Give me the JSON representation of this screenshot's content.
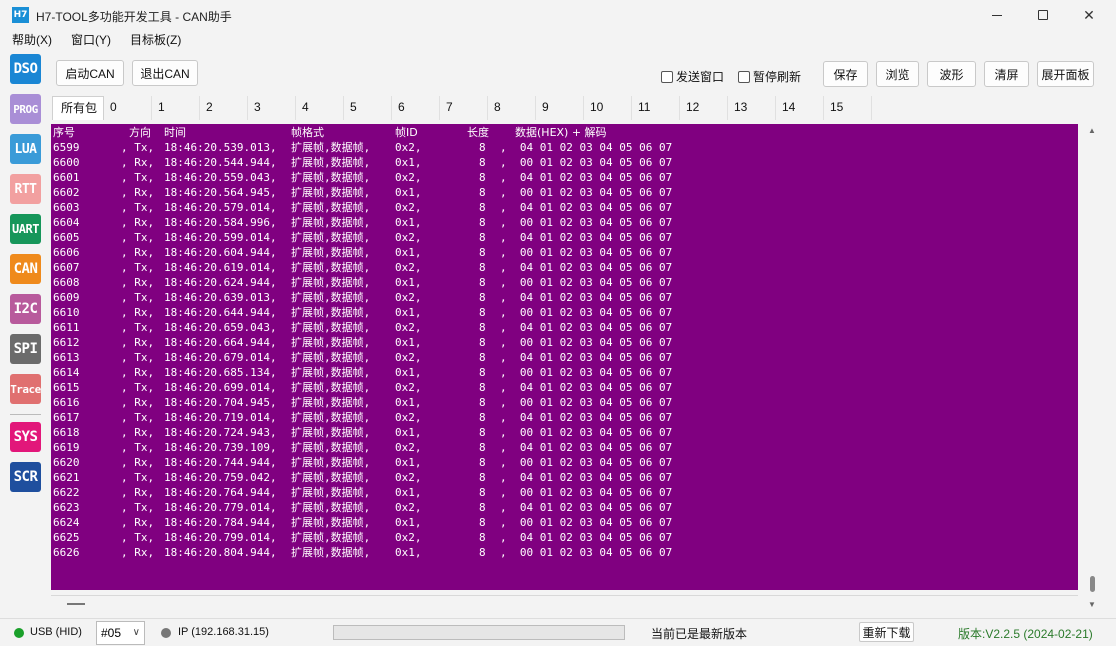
{
  "window": {
    "icon_text": "H7",
    "title": "H7-TOOL多功能开发工具 - CAN助手"
  },
  "menu": [
    "帮助(X)",
    "窗口(Y)",
    "目标板(Z)"
  ],
  "sidebar": [
    {
      "label": "DSO",
      "color": "#1a86d4"
    },
    {
      "label": "PROG",
      "color": "#a98ed6"
    },
    {
      "label": "LUA",
      "color": "#3a9bd8"
    },
    {
      "label": "RTT",
      "color": "#f2a0a0"
    },
    {
      "label": "UART",
      "color": "#16965a"
    },
    {
      "label": "CAN",
      "color": "#ef8a1c"
    },
    {
      "label": "I2C",
      "color": "#b85a9c"
    },
    {
      "label": "SPI",
      "color": "#6b6b6b"
    },
    {
      "label": "Trace",
      "color": "#e07070"
    },
    {
      "label": "SYS",
      "color": "#e2177a"
    },
    {
      "label": "SCR",
      "color": "#1f4f9e"
    }
  ],
  "toolbar": {
    "start_can": "启动CAN",
    "exit_can": "退出CAN",
    "send_window": "发送窗口",
    "pause_refresh": "暂停刷新",
    "save": "保存",
    "browse": "浏览",
    "waveform": "波形",
    "clear": "清屏",
    "expand_panel": "展开面板"
  },
  "tabs": [
    "所有包",
    "0",
    "1",
    "2",
    "3",
    "4",
    "5",
    "6",
    "7",
    "8",
    "9",
    "10",
    "11",
    "12",
    "13",
    "14",
    "15"
  ],
  "table": {
    "header": {
      "seq": "序号",
      "dir": "方向",
      "time": "时间",
      "fmt": "帧格式",
      "id": "帧ID",
      "len": "长度",
      "data": "数据(HEX) + 解码"
    },
    "rows": [
      {
        "seq": "6599",
        "dir": ", Tx,",
        "time": "18:46:20.539.013,",
        "fmt": "扩展帧,数据帧,",
        "id": "0x2,",
        "len": "8",
        "data": ",  04 01 02 03 04 05 06 07"
      },
      {
        "seq": "6600",
        "dir": ", Rx,",
        "time": "18:46:20.544.944,",
        "fmt": "扩展帧,数据帧,",
        "id": "0x1,",
        "len": "8",
        "data": ",  00 01 02 03 04 05 06 07"
      },
      {
        "seq": "6601",
        "dir": ", Tx,",
        "time": "18:46:20.559.043,",
        "fmt": "扩展帧,数据帧,",
        "id": "0x2,",
        "len": "8",
        "data": ",  04 01 02 03 04 05 06 07"
      },
      {
        "seq": "6602",
        "dir": ", Rx,",
        "time": "18:46:20.564.945,",
        "fmt": "扩展帧,数据帧,",
        "id": "0x1,",
        "len": "8",
        "data": ",  00 01 02 03 04 05 06 07"
      },
      {
        "seq": "6603",
        "dir": ", Tx,",
        "time": "18:46:20.579.014,",
        "fmt": "扩展帧,数据帧,",
        "id": "0x2,",
        "len": "8",
        "data": ",  04 01 02 03 04 05 06 07"
      },
      {
        "seq": "6604",
        "dir": ", Rx,",
        "time": "18:46:20.584.996,",
        "fmt": "扩展帧,数据帧,",
        "id": "0x1,",
        "len": "8",
        "data": ",  00 01 02 03 04 05 06 07"
      },
      {
        "seq": "6605",
        "dir": ", Tx,",
        "time": "18:46:20.599.014,",
        "fmt": "扩展帧,数据帧,",
        "id": "0x2,",
        "len": "8",
        "data": ",  04 01 02 03 04 05 06 07"
      },
      {
        "seq": "6606",
        "dir": ", Rx,",
        "time": "18:46:20.604.944,",
        "fmt": "扩展帧,数据帧,",
        "id": "0x1,",
        "len": "8",
        "data": ",  00 01 02 03 04 05 06 07"
      },
      {
        "seq": "6607",
        "dir": ", Tx,",
        "time": "18:46:20.619.014,",
        "fmt": "扩展帧,数据帧,",
        "id": "0x2,",
        "len": "8",
        "data": ",  04 01 02 03 04 05 06 07"
      },
      {
        "seq": "6608",
        "dir": ", Rx,",
        "time": "18:46:20.624.944,",
        "fmt": "扩展帧,数据帧,",
        "id": "0x1,",
        "len": "8",
        "data": ",  00 01 02 03 04 05 06 07"
      },
      {
        "seq": "6609",
        "dir": ", Tx,",
        "time": "18:46:20.639.013,",
        "fmt": "扩展帧,数据帧,",
        "id": "0x2,",
        "len": "8",
        "data": ",  04 01 02 03 04 05 06 07"
      },
      {
        "seq": "6610",
        "dir": ", Rx,",
        "time": "18:46:20.644.944,",
        "fmt": "扩展帧,数据帧,",
        "id": "0x1,",
        "len": "8",
        "data": ",  00 01 02 03 04 05 06 07"
      },
      {
        "seq": "6611",
        "dir": ", Tx,",
        "time": "18:46:20.659.043,",
        "fmt": "扩展帧,数据帧,",
        "id": "0x2,",
        "len": "8",
        "data": ",  04 01 02 03 04 05 06 07"
      },
      {
        "seq": "6612",
        "dir": ", Rx,",
        "time": "18:46:20.664.944,",
        "fmt": "扩展帧,数据帧,",
        "id": "0x1,",
        "len": "8",
        "data": ",  00 01 02 03 04 05 06 07"
      },
      {
        "seq": "6613",
        "dir": ", Tx,",
        "time": "18:46:20.679.014,",
        "fmt": "扩展帧,数据帧,",
        "id": "0x2,",
        "len": "8",
        "data": ",  04 01 02 03 04 05 06 07"
      },
      {
        "seq": "6614",
        "dir": ", Rx,",
        "time": "18:46:20.685.134,",
        "fmt": "扩展帧,数据帧,",
        "id": "0x1,",
        "len": "8",
        "data": ",  00 01 02 03 04 05 06 07"
      },
      {
        "seq": "6615",
        "dir": ", Tx,",
        "time": "18:46:20.699.014,",
        "fmt": "扩展帧,数据帧,",
        "id": "0x2,",
        "len": "8",
        "data": ",  04 01 02 03 04 05 06 07"
      },
      {
        "seq": "6616",
        "dir": ", Rx,",
        "time": "18:46:20.704.945,",
        "fmt": "扩展帧,数据帧,",
        "id": "0x1,",
        "len": "8",
        "data": ",  00 01 02 03 04 05 06 07"
      },
      {
        "seq": "6617",
        "dir": ", Tx,",
        "time": "18:46:20.719.014,",
        "fmt": "扩展帧,数据帧,",
        "id": "0x2,",
        "len": "8",
        "data": ",  04 01 02 03 04 05 06 07"
      },
      {
        "seq": "6618",
        "dir": ", Rx,",
        "time": "18:46:20.724.943,",
        "fmt": "扩展帧,数据帧,",
        "id": "0x1,",
        "len": "8",
        "data": ",  00 01 02 03 04 05 06 07"
      },
      {
        "seq": "6619",
        "dir": ", Tx,",
        "time": "18:46:20.739.109,",
        "fmt": "扩展帧,数据帧,",
        "id": "0x2,",
        "len": "8",
        "data": ",  04 01 02 03 04 05 06 07"
      },
      {
        "seq": "6620",
        "dir": ", Rx,",
        "time": "18:46:20.744.944,",
        "fmt": "扩展帧,数据帧,",
        "id": "0x1,",
        "len": "8",
        "data": ",  00 01 02 03 04 05 06 07"
      },
      {
        "seq": "6621",
        "dir": ", Tx,",
        "time": "18:46:20.759.042,",
        "fmt": "扩展帧,数据帧,",
        "id": "0x2,",
        "len": "8",
        "data": ",  04 01 02 03 04 05 06 07"
      },
      {
        "seq": "6622",
        "dir": ", Rx,",
        "time": "18:46:20.764.944,",
        "fmt": "扩展帧,数据帧,",
        "id": "0x1,",
        "len": "8",
        "data": ",  00 01 02 03 04 05 06 07"
      },
      {
        "seq": "6623",
        "dir": ", Tx,",
        "time": "18:46:20.779.014,",
        "fmt": "扩展帧,数据帧,",
        "id": "0x2,",
        "len": "8",
        "data": ",  04 01 02 03 04 05 06 07"
      },
      {
        "seq": "6624",
        "dir": ", Rx,",
        "time": "18:46:20.784.944,",
        "fmt": "扩展帧,数据帧,",
        "id": "0x1,",
        "len": "8",
        "data": ",  00 01 02 03 04 05 06 07"
      },
      {
        "seq": "6625",
        "dir": ", Tx,",
        "time": "18:46:20.799.014,",
        "fmt": "扩展帧,数据帧,",
        "id": "0x2,",
        "len": "8",
        "data": ",  04 01 02 03 04 05 06 07"
      },
      {
        "seq": "6626",
        "dir": ", Rx,",
        "time": "18:46:20.804.944,",
        "fmt": "扩展帧,数据帧,",
        "id": "0x1,",
        "len": "8",
        "data": ",  00 01 02 03 04 05 06 07"
      }
    ]
  },
  "status": {
    "usb": "USB (HID)",
    "usb_color": "#1aa02a",
    "device": "#05",
    "ip": "IP (192.168.31.15)",
    "ip_color": "#777777",
    "progress": 0,
    "message": "当前已是最新版本",
    "redownload": "重新下载",
    "version": "版本:V2.2.5 (2024-02-21)",
    "version_color": "#2a7a2a"
  }
}
